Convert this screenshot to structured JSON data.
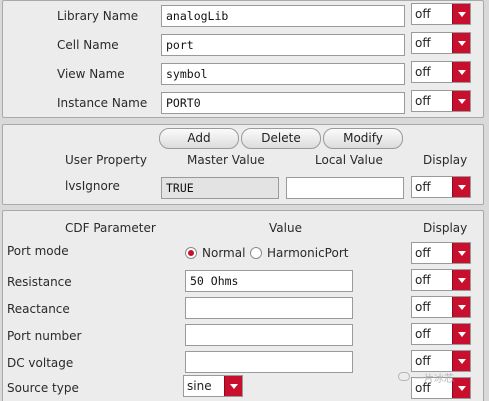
{
  "top": {
    "rows": [
      {
        "label": "Library Name",
        "value": "analogLib",
        "display": "off"
      },
      {
        "label": "Cell Name",
        "value": "port",
        "display": "off"
      },
      {
        "label": "View Name",
        "value": "symbol",
        "display": "off"
      },
      {
        "label": "Instance Name",
        "value": "PORT0",
        "display": "off"
      }
    ]
  },
  "props": {
    "buttons": {
      "add": "Add",
      "delete": "Delete",
      "modify": "Modify"
    },
    "headers": {
      "user_property": "User Property",
      "master_value": "Master Value",
      "local_value": "Local Value",
      "display": "Display"
    },
    "row": {
      "label": "lvsIgnore",
      "master": "TRUE",
      "local": "",
      "display": "off"
    }
  },
  "cdf": {
    "headers": {
      "parameter": "CDF Parameter",
      "value": "Value",
      "display": "Display"
    },
    "port_mode": {
      "label": "Port mode",
      "options": [
        "Normal",
        "HarmonicPort"
      ],
      "selected": "Normal",
      "display": "off"
    },
    "rows": [
      {
        "label": "Resistance",
        "value": "50 Ohms",
        "display": "off"
      },
      {
        "label": "Reactance",
        "value": "",
        "display": "off"
      },
      {
        "label": "Port number",
        "value": "",
        "display": "off"
      },
      {
        "label": "DC voltage",
        "value": "",
        "display": "off"
      }
    ],
    "source_type": {
      "label": "Source type",
      "value": "sine",
      "display": "off"
    }
  },
  "watermark": "一片冰芯",
  "colors": {
    "dropdown_arrow": "#c8102e",
    "radio_selected": "#c8102e"
  }
}
